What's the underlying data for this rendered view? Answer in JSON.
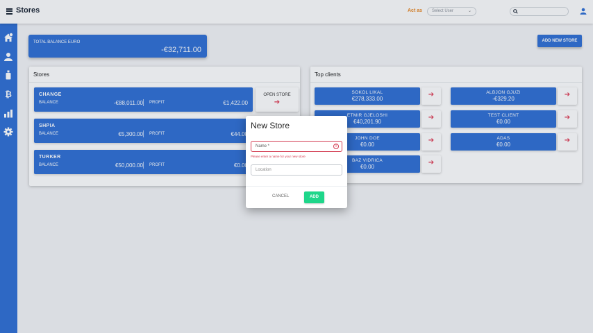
{
  "header": {
    "title": "Stores",
    "act_as_label": "Act as",
    "user_select_value": "Select User",
    "user_select_chevron": "⌄"
  },
  "sidebar": {
    "items": [
      {
        "name": "home-icon"
      },
      {
        "name": "users-icon"
      },
      {
        "name": "bottle-icon"
      },
      {
        "name": "bitcoin-icon"
      },
      {
        "name": "chart-icon"
      },
      {
        "name": "settings-icon"
      }
    ]
  },
  "summary": {
    "balance_label": "TOTAL BALANCE EURO",
    "balance_value": "-€32,711.00",
    "add_store_label": "ADD NEW STORE"
  },
  "stores": {
    "title": "Stores",
    "balance_label": "BALANCE",
    "profit_label": "PROFIT",
    "open_store_label": "OPEN STORE",
    "arrow": "➔",
    "items": [
      {
        "name": "CHANGE",
        "balance": "-€88,011.00",
        "profit": "€1,422.00"
      },
      {
        "name": "SHPIA",
        "balance": "€5,300.00",
        "profit": "€44.00"
      },
      {
        "name": "TURKER",
        "balance": "€50,000.00",
        "profit": "€0.00"
      }
    ]
  },
  "top_clients": {
    "title": "Top clients",
    "arrow": "➔",
    "items": [
      {
        "name": "SOKOL LIKAL",
        "value": "€278,333.00"
      },
      {
        "name": "ALBJON GJUZI",
        "value": "-€329.20"
      },
      {
        "name": "ETMIR GJELOSHI",
        "value": "€40,201.90"
      },
      {
        "name": "TEST CLIENT",
        "value": "€0.00"
      },
      {
        "name": "JOHN DOE",
        "value": "€0.00"
      },
      {
        "name": "ADAS",
        "value": "€0.00"
      },
      {
        "name": "BAZ VIDRICA",
        "value": "€0.00"
      }
    ]
  },
  "dialog": {
    "title": "New Store",
    "name_placeholder": "Name *",
    "name_error": "Please enter a name for your new store",
    "error_icon": "!",
    "location_placeholder": "Location",
    "cancel_label": "CANCEL",
    "add_label": "ADD"
  },
  "colors": {
    "primary": "#2f6fd4",
    "accent_arrow": "#e03a52",
    "add_button": "#1ed68a",
    "error": "#d3394f",
    "act_as": "#e8841e"
  }
}
